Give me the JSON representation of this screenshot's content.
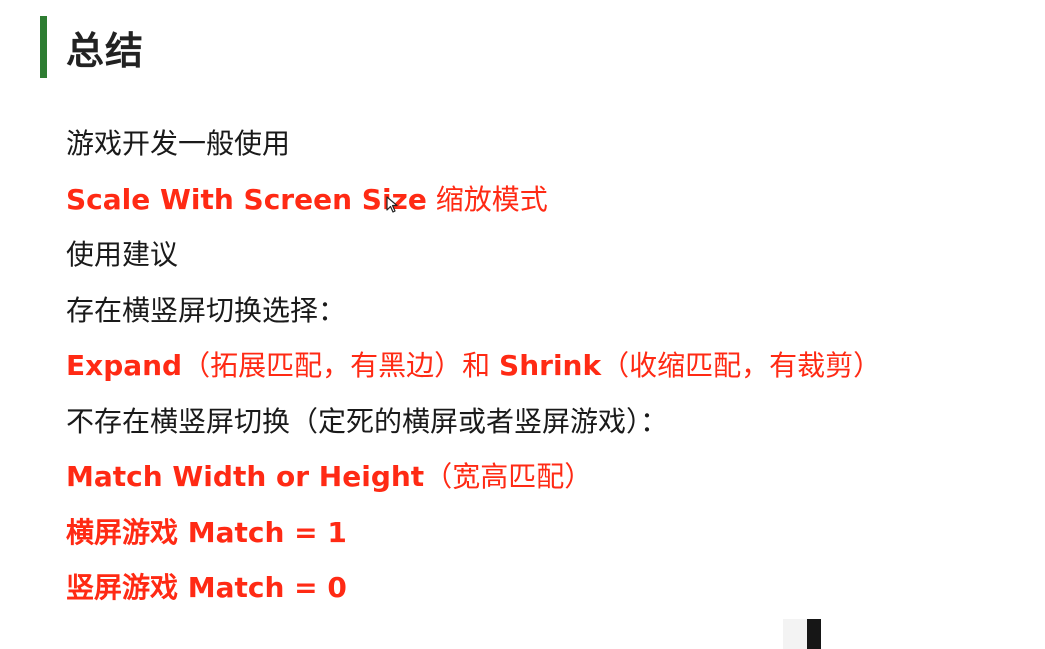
{
  "slide": {
    "title": "总结",
    "line1": "游戏开发一般使用",
    "line2": {
      "mode_name": "Scale With Screen Size",
      "mode_suffix": "缩放模式"
    },
    "line3": "使用建议",
    "line4": "存在横竖屏切换选择：",
    "line5": {
      "expand": "Expand",
      "expand_desc": "（拓展匹配，有黑边）和",
      "shrink": "Shrink",
      "shrink_desc": "（收缩匹配，有裁剪）"
    },
    "line6": "不存在横竖屏切换（定死的横屏或者竖屏游戏）：",
    "line7": {
      "mode_name": "Match Width or Height",
      "mode_desc": "（宽高匹配）"
    },
    "line8": "横屏游戏 Match = 1",
    "line9": "竖屏游戏 Match = 0"
  },
  "colors": {
    "accent_bar": "#2e7d32",
    "highlight_red": "#ff2a14",
    "body_text": "#1a1a1a"
  },
  "icons": {
    "cursor": "mouse-pointer-icon"
  }
}
